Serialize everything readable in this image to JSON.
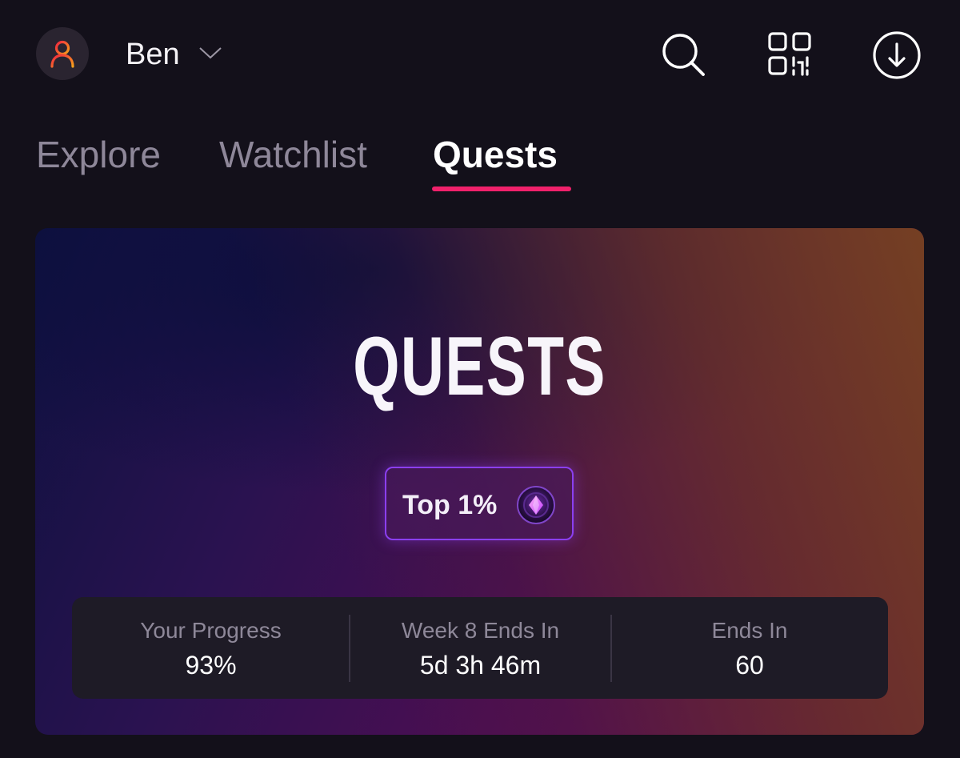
{
  "header": {
    "username": "Ben",
    "icons": {
      "avatar": "user-icon",
      "dropdown": "chevron-down-icon",
      "search": "search-icon",
      "qr": "qr-code-icon",
      "download": "download-icon"
    },
    "avatar_colors": [
      "#f2253f",
      "#f7a21b"
    ]
  },
  "tabs": [
    {
      "label": "Explore",
      "active": false
    },
    {
      "label": "Watchlist",
      "active": false
    },
    {
      "label": "Quests",
      "active": true
    }
  ],
  "accent_color": "#f0216b",
  "hero": {
    "title": "QUESTS",
    "rank_badge": {
      "label": "Top 1%",
      "icon": "gem-icon",
      "border_color": "#8b3ff0"
    },
    "stats": [
      {
        "label": "Your Progress",
        "value": "93%"
      },
      {
        "label": "Week 8 Ends In",
        "value": "5d 3h 46m"
      },
      {
        "label": "Ends In",
        "value": "60"
      }
    ]
  }
}
